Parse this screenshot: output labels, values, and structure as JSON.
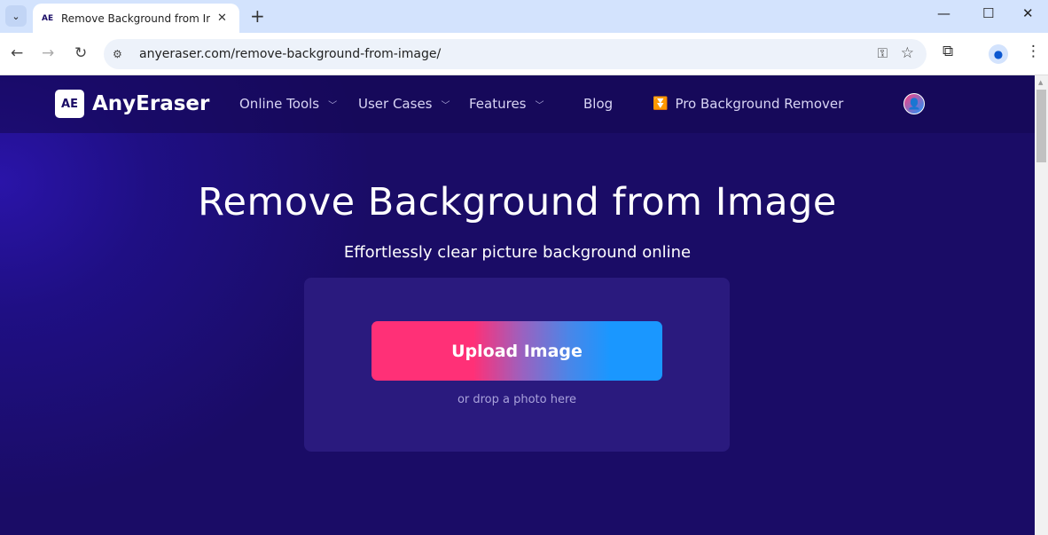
{
  "browser": {
    "tab_title": "Remove Background from Image",
    "tab_favicon": "AE",
    "url": "anyeraser.com/remove-background-from-image/",
    "icons": [
      "chevron-down-icon",
      "close-icon",
      "plus-icon",
      "minimize-icon",
      "maximize-icon",
      "window-close-icon",
      "back-icon",
      "forward-icon",
      "reload-icon",
      "site-settings-icon",
      "key-icon",
      "star-icon",
      "extensions-icon",
      "profile-icon",
      "more-icon"
    ]
  },
  "site": {
    "logo_mark": "AE",
    "logo_name": "AnyEraser",
    "nav": [
      {
        "label": "Online Tools",
        "dropdown": true
      },
      {
        "label": "User Cases",
        "dropdown": true
      },
      {
        "label": "Features",
        "dropdown": true
      },
      {
        "label": "Blog",
        "dropdown": false
      },
      {
        "label": "Pro Background Remover",
        "icon": "download-tray-icon"
      }
    ]
  },
  "hero": {
    "title": "Remove Background from Image",
    "subtitle": "Effortlessly clear picture background online",
    "upload_label": "Upload Image",
    "drop_hint": "or drop a photo here"
  },
  "colors": {
    "accent_pink": "#ff3077",
    "accent_blue": "#1a97ff",
    "bg": "#1a0c66"
  }
}
